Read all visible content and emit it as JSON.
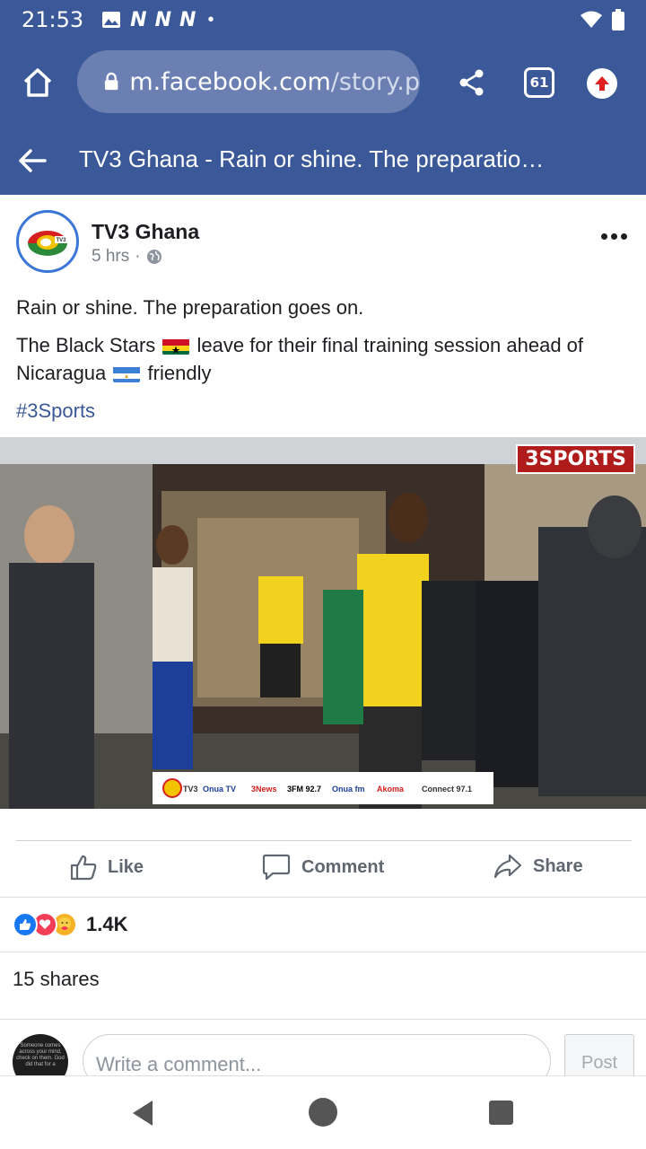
{
  "status_bar": {
    "time": "21:53",
    "carrier_icons": [
      "N",
      "N",
      "N"
    ],
    "dot": "•"
  },
  "browser": {
    "url_host": "m.facebook.com",
    "url_path": "/story.p",
    "tab_count": "61"
  },
  "page_header": {
    "title": "TV3 Ghana - Rain or shine. The preparatio…"
  },
  "post": {
    "page_name": "TV3 Ghana",
    "time_ago": "5 hrs",
    "meta_separator": "·",
    "avatar_label": "TV3",
    "line1": "Rain or shine. The preparation goes on.",
    "line2_a": "The Black Stars",
    "line2_b": "leave for their final training session ahead of Nicaragua",
    "line2_c": "friendly",
    "hashtag": "#3Sports"
  },
  "media": {
    "badge": "3SPORTS",
    "ticker_logos": [
      "TV3",
      "Onua TV",
      "3News",
      "3FM 92.7",
      "Onua fm",
      "Akoma",
      "Connect 97.1"
    ]
  },
  "actions": {
    "like": "Like",
    "comment": "Comment",
    "share": "Share"
  },
  "engagement": {
    "reaction_count": "1.4K",
    "shares": "15 shares",
    "reactions": [
      "like",
      "love",
      "care"
    ]
  },
  "comment_box": {
    "placeholder": "Write a comment...",
    "post_label": "Post",
    "avatar_text": "Someone comes across your mind, check on them. God did that for a"
  },
  "colors": {
    "facebook_blue": "#3b5998",
    "url_box": "#6b7fb3",
    "like_blue": "#1877f2",
    "love_red": "#f33e58",
    "care_yellow": "#f7b125"
  }
}
